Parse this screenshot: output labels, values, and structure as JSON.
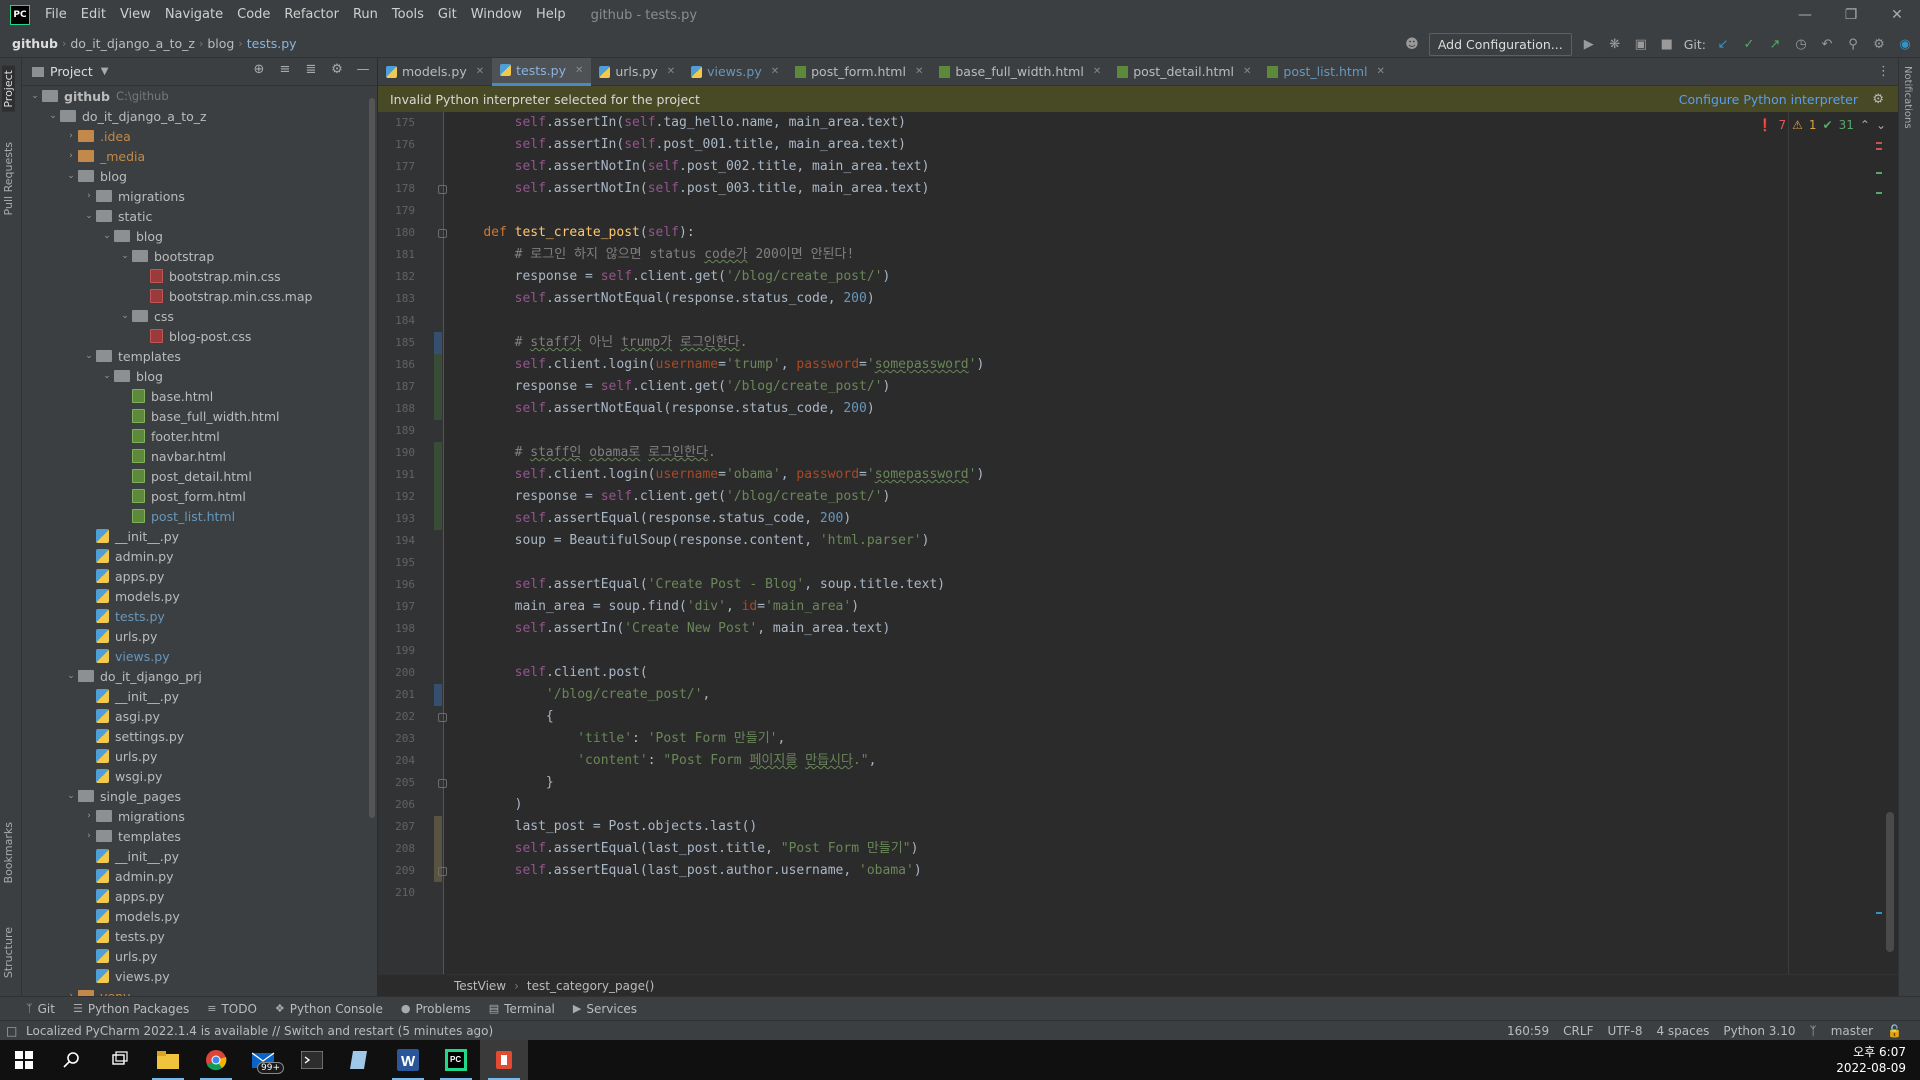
{
  "menu": {
    "items": [
      "File",
      "Edit",
      "View",
      "Navigate",
      "Code",
      "Refactor",
      "Run",
      "Tools",
      "Git",
      "Window",
      "Help"
    ],
    "window_title": "github - tests.py"
  },
  "nav": {
    "crumbs": [
      "github",
      "do_it_django_a_to_z",
      "blog",
      "tests.py"
    ],
    "add_config": "Add Configuration...",
    "git_label": "Git:"
  },
  "project": {
    "title": "Project",
    "tree": [
      {
        "label": "github",
        "hint": "C:\\github",
        "indent": 0,
        "kind": "folder",
        "arrow": "open",
        "bold": true
      },
      {
        "label": "do_it_django_a_to_z",
        "indent": 1,
        "kind": "folder",
        "arrow": "open"
      },
      {
        "label": ".idea",
        "indent": 2,
        "kind": "folder",
        "arrow": "closed",
        "color": "orange"
      },
      {
        "label": "_media",
        "indent": 2,
        "kind": "folder",
        "arrow": "closed",
        "color": "orange"
      },
      {
        "label": "blog",
        "indent": 2,
        "kind": "folder",
        "arrow": "open"
      },
      {
        "label": "migrations",
        "indent": 3,
        "kind": "folder",
        "arrow": "closed"
      },
      {
        "label": "static",
        "indent": 3,
        "kind": "folder",
        "arrow": "open"
      },
      {
        "label": "blog",
        "indent": 4,
        "kind": "folder",
        "arrow": "open"
      },
      {
        "label": "bootstrap",
        "indent": 5,
        "kind": "folder",
        "arrow": "open"
      },
      {
        "label": "bootstrap.min.css",
        "indent": 6,
        "kind": "css"
      },
      {
        "label": "bootstrap.min.css.map",
        "indent": 6,
        "kind": "css"
      },
      {
        "label": "css",
        "indent": 5,
        "kind": "folder",
        "arrow": "open"
      },
      {
        "label": "blog-post.css",
        "indent": 6,
        "kind": "css"
      },
      {
        "label": "templates",
        "indent": 3,
        "kind": "folder",
        "arrow": "open"
      },
      {
        "label": "blog",
        "indent": 4,
        "kind": "folder",
        "arrow": "open"
      },
      {
        "label": "base.html",
        "indent": 5,
        "kind": "html"
      },
      {
        "label": "base_full_width.html",
        "indent": 5,
        "kind": "html"
      },
      {
        "label": "footer.html",
        "indent": 5,
        "kind": "html"
      },
      {
        "label": "navbar.html",
        "indent": 5,
        "kind": "html"
      },
      {
        "label": "post_detail.html",
        "indent": 5,
        "kind": "html"
      },
      {
        "label": "post_form.html",
        "indent": 5,
        "kind": "html"
      },
      {
        "label": "post_list.html",
        "indent": 5,
        "kind": "html",
        "color": "modified"
      },
      {
        "label": "__init__.py",
        "indent": 3,
        "kind": "py"
      },
      {
        "label": "admin.py",
        "indent": 3,
        "kind": "py"
      },
      {
        "label": "apps.py",
        "indent": 3,
        "kind": "py"
      },
      {
        "label": "models.py",
        "indent": 3,
        "kind": "py"
      },
      {
        "label": "tests.py",
        "indent": 3,
        "kind": "py",
        "color": "modified"
      },
      {
        "label": "urls.py",
        "indent": 3,
        "kind": "py"
      },
      {
        "label": "views.py",
        "indent": 3,
        "kind": "py",
        "color": "modified"
      },
      {
        "label": "do_it_django_prj",
        "indent": 2,
        "kind": "folder",
        "arrow": "open"
      },
      {
        "label": "__init__.py",
        "indent": 3,
        "kind": "py"
      },
      {
        "label": "asgi.py",
        "indent": 3,
        "kind": "py"
      },
      {
        "label": "settings.py",
        "indent": 3,
        "kind": "py"
      },
      {
        "label": "urls.py",
        "indent": 3,
        "kind": "py"
      },
      {
        "label": "wsgi.py",
        "indent": 3,
        "kind": "py"
      },
      {
        "label": "single_pages",
        "indent": 2,
        "kind": "folder",
        "arrow": "open"
      },
      {
        "label": "migrations",
        "indent": 3,
        "kind": "folder",
        "arrow": "closed"
      },
      {
        "label": "templates",
        "indent": 3,
        "kind": "folder",
        "arrow": "closed"
      },
      {
        "label": "__init__.py",
        "indent": 3,
        "kind": "py"
      },
      {
        "label": "admin.py",
        "indent": 3,
        "kind": "py"
      },
      {
        "label": "apps.py",
        "indent": 3,
        "kind": "py"
      },
      {
        "label": "models.py",
        "indent": 3,
        "kind": "py"
      },
      {
        "label": "tests.py",
        "indent": 3,
        "kind": "py"
      },
      {
        "label": "urls.py",
        "indent": 3,
        "kind": "py"
      },
      {
        "label": "views.py",
        "indent": 3,
        "kind": "py"
      },
      {
        "label": "venv",
        "indent": 2,
        "kind": "folder",
        "arrow": "closed",
        "color": "orange"
      }
    ]
  },
  "tabs": [
    {
      "label": "models.py",
      "icon": "py"
    },
    {
      "label": "tests.py",
      "icon": "py",
      "active": true
    },
    {
      "label": "urls.py",
      "icon": "py"
    },
    {
      "label": "views.py",
      "icon": "py",
      "color": "blue"
    },
    {
      "label": "post_form.html",
      "icon": "html"
    },
    {
      "label": "base_full_width.html",
      "icon": "html"
    },
    {
      "label": "post_detail.html",
      "icon": "html"
    },
    {
      "label": "post_list.html",
      "icon": "html",
      "color": "blue"
    }
  ],
  "banner": {
    "message": "Invalid Python interpreter selected for the project",
    "action": "Configure Python interpreter"
  },
  "inspections": {
    "errors": "7",
    "warnings": "1",
    "ok": "31"
  },
  "code": {
    "first_line": 175,
    "lines": [
      [
        [
          "        ",
          ""
        ],
        [
          "self",
          "sf"
        ],
        [
          ".assertIn(",
          ""
        ],
        [
          "self",
          "sf"
        ],
        [
          ".tag_hello.name, main_area.text)",
          ""
        ]
      ],
      [
        [
          "        ",
          ""
        ],
        [
          "self",
          "sf"
        ],
        [
          ".assertIn(",
          ""
        ],
        [
          "self",
          "sf"
        ],
        [
          ".post_001.title, main_area.text)",
          ""
        ]
      ],
      [
        [
          "        ",
          ""
        ],
        [
          "self",
          "sf"
        ],
        [
          ".assertNotIn(",
          ""
        ],
        [
          "self",
          "sf"
        ],
        [
          ".post_002.title, main_area.text)",
          ""
        ]
      ],
      [
        [
          "        ",
          ""
        ],
        [
          "self",
          "sf"
        ],
        [
          ".assertNotIn(",
          ""
        ],
        [
          "self",
          "sf"
        ],
        [
          ".post_003.title, main_area.text)",
          ""
        ]
      ],
      [],
      [
        [
          "    ",
          ""
        ],
        [
          "def ",
          "k"
        ],
        [
          "test_create_post",
          "fn"
        ],
        [
          "(",
          ""
        ],
        [
          "self",
          "sf"
        ],
        [
          "):",
          ""
        ]
      ],
      [
        [
          "        ",
          ""
        ],
        [
          "# 로그인 하지 않으면 status ",
          "c"
        ],
        [
          "code가",
          "c squig"
        ],
        [
          " 200이면 안된다!",
          "c"
        ]
      ],
      [
        [
          "        response = ",
          ""
        ],
        [
          "self",
          "sf"
        ],
        [
          ".client.get(",
          ""
        ],
        [
          "'/blog/create_post/'",
          "s"
        ],
        [
          ")",
          ""
        ]
      ],
      [
        [
          "        ",
          ""
        ],
        [
          "self",
          "sf"
        ],
        [
          ".assertNotEqual(response.status_code, ",
          ""
        ],
        [
          "200",
          "n"
        ],
        [
          ")",
          ""
        ]
      ],
      [],
      [
        [
          "        ",
          ""
        ],
        [
          "# ",
          "c"
        ],
        [
          "staff가",
          "c squig"
        ],
        [
          " 아닌 ",
          "c"
        ],
        [
          "trump가",
          "c squig"
        ],
        [
          " ",
          "c"
        ],
        [
          "로그인한다",
          "c squig"
        ],
        [
          ".",
          "c"
        ]
      ],
      [
        [
          "        ",
          ""
        ],
        [
          "self",
          "sf"
        ],
        [
          ".client.login(",
          ""
        ],
        [
          "username",
          "p"
        ],
        [
          "=",
          ""
        ],
        [
          "'trump'",
          "s"
        ],
        [
          ", ",
          ""
        ],
        [
          "password",
          "p"
        ],
        [
          "=",
          ""
        ],
        [
          "'",
          "s"
        ],
        [
          "somepassword",
          "s squig"
        ],
        [
          "'",
          "s"
        ],
        [
          ")",
          ""
        ]
      ],
      [
        [
          "        response = ",
          ""
        ],
        [
          "self",
          "sf"
        ],
        [
          ".client.get(",
          ""
        ],
        [
          "'/blog/create_post/'",
          "s"
        ],
        [
          ")",
          ""
        ]
      ],
      [
        [
          "        ",
          ""
        ],
        [
          "self",
          "sf"
        ],
        [
          ".assertNotEqual(response.status_code, ",
          ""
        ],
        [
          "200",
          "n"
        ],
        [
          ")",
          ""
        ]
      ],
      [],
      [
        [
          "        ",
          ""
        ],
        [
          "# ",
          "c"
        ],
        [
          "staff인",
          "c squig"
        ],
        [
          " ",
          "c"
        ],
        [
          "obama로",
          "c squig"
        ],
        [
          " ",
          "c"
        ],
        [
          "로그인한다",
          "c squig"
        ],
        [
          ".",
          "c"
        ]
      ],
      [
        [
          "        ",
          ""
        ],
        [
          "self",
          "sf"
        ],
        [
          ".client.login(",
          ""
        ],
        [
          "username",
          "p"
        ],
        [
          "=",
          ""
        ],
        [
          "'obama'",
          "s"
        ],
        [
          ", ",
          ""
        ],
        [
          "password",
          "p"
        ],
        [
          "=",
          ""
        ],
        [
          "'",
          "s"
        ],
        [
          "somepassword",
          "s squig"
        ],
        [
          "'",
          "s"
        ],
        [
          ")",
          ""
        ]
      ],
      [
        [
          "        response = ",
          ""
        ],
        [
          "self",
          "sf"
        ],
        [
          ".client.get(",
          ""
        ],
        [
          "'/blog/create_post/'",
          "s"
        ],
        [
          ")",
          ""
        ]
      ],
      [
        [
          "        ",
          ""
        ],
        [
          "self",
          "sf"
        ],
        [
          ".assertEqual(response.status_code, ",
          ""
        ],
        [
          "200",
          "n"
        ],
        [
          ")",
          ""
        ]
      ],
      [
        [
          "        soup = BeautifulSoup(response.content, ",
          ""
        ],
        [
          "'html.parser'",
          "s"
        ],
        [
          ")",
          ""
        ]
      ],
      [],
      [
        [
          "        ",
          ""
        ],
        [
          "self",
          "sf"
        ],
        [
          ".assertEqual(",
          ""
        ],
        [
          "'Create Post - Blog'",
          "s"
        ],
        [
          ", soup.title.text)",
          ""
        ]
      ],
      [
        [
          "        main_area = soup.find(",
          ""
        ],
        [
          "'div'",
          "s"
        ],
        [
          ", ",
          ""
        ],
        [
          "id",
          "p"
        ],
        [
          "=",
          ""
        ],
        [
          "'main_area'",
          "s"
        ],
        [
          ")",
          ""
        ]
      ],
      [
        [
          "        ",
          ""
        ],
        [
          "self",
          "sf"
        ],
        [
          ".assertIn(",
          ""
        ],
        [
          "'Create New Post'",
          "s"
        ],
        [
          ", main_area.text)",
          ""
        ]
      ],
      [],
      [
        [
          "        ",
          ""
        ],
        [
          "self",
          "sf"
        ],
        [
          ".client.post(",
          ""
        ]
      ],
      [
        [
          "            ",
          ""
        ],
        [
          "'/blog/create_post/'",
          "s"
        ],
        [
          ",",
          ""
        ]
      ],
      [
        [
          "            {",
          ""
        ]
      ],
      [
        [
          "                ",
          ""
        ],
        [
          "'title'",
          "s"
        ],
        [
          ": ",
          ""
        ],
        [
          "'Post Form 만들기'",
          "s"
        ],
        [
          ",",
          ""
        ]
      ],
      [
        [
          "                ",
          ""
        ],
        [
          "'content'",
          "s"
        ],
        [
          ": ",
          ""
        ],
        [
          "\"Post Form ",
          "s"
        ],
        [
          "페이지를",
          "s squig"
        ],
        [
          " ",
          "s"
        ],
        [
          "만듭시다",
          "s squig"
        ],
        [
          ".\"",
          "s"
        ],
        [
          ",",
          ""
        ]
      ],
      [
        [
          "            }",
          ""
        ]
      ],
      [
        [
          "        )",
          ""
        ]
      ],
      [
        [
          "        last_post = Post.objects.last()",
          ""
        ]
      ],
      [
        [
          "        ",
          ""
        ],
        [
          "self",
          "sf"
        ],
        [
          ".assertEqual(last_post.title, ",
          ""
        ],
        [
          "\"Post Form 만들기\"",
          "s"
        ],
        [
          ")",
          ""
        ]
      ],
      [
        [
          "        ",
          ""
        ],
        [
          "self",
          "sf"
        ],
        [
          ".assertEqual(last_post.author.username, ",
          ""
        ],
        [
          "'obama'",
          "s"
        ],
        [
          ")",
          ""
        ]
      ],
      []
    ]
  },
  "code_crumbs": [
    "TestView",
    "test_category_page()"
  ],
  "bottom_tools": [
    "Git",
    "Python Packages",
    "TODO",
    "Python Console",
    "Problems",
    "Terminal",
    "Services"
  ],
  "status": {
    "message": "Localized PyCharm 2022.1.4 is available // Switch and restart (5 minutes ago)",
    "position": "160:59",
    "line_sep": "CRLF",
    "encoding": "UTF-8",
    "indent": "4 spaces",
    "interpreter": "Python 3.10",
    "branch": "master"
  },
  "taskbar": {
    "badge": "99+",
    "time": "오후 6:07",
    "date": "2022-08-09"
  },
  "side_tabs": {
    "project": "Project",
    "pull": "Pull Requests",
    "bookmarks": "Bookmarks",
    "structure": "Structure",
    "notifications": "Notifications"
  }
}
